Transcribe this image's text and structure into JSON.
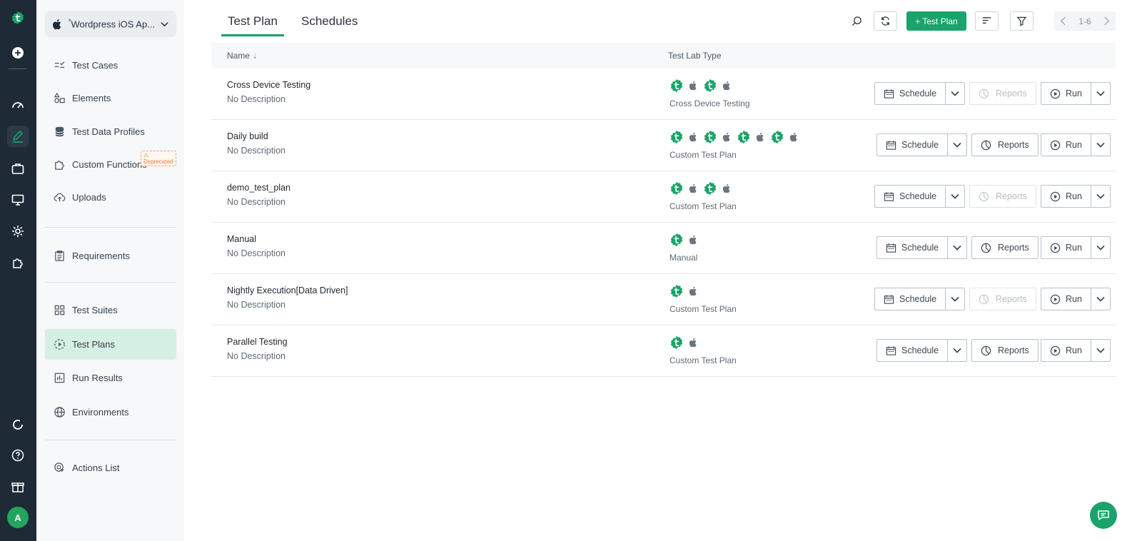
{
  "rail": {
    "avatar_letter": "A"
  },
  "sidebar": {
    "project": {
      "modified_mark": "*",
      "name": "Wordpress iOS Ap..."
    },
    "items": [
      {
        "label": "Test Cases"
      },
      {
        "label": "Elements"
      },
      {
        "label": "Test Data Profiles"
      },
      {
        "label": "Custom Functions",
        "badge": "Deprecated"
      },
      {
        "label": "Uploads"
      },
      {
        "label": "Requirements"
      },
      {
        "label": "Test Suites"
      },
      {
        "label": "Test Plans"
      },
      {
        "label": "Run Results"
      },
      {
        "label": "Environments"
      },
      {
        "label": "Actions List"
      }
    ]
  },
  "header": {
    "tabs": [
      {
        "label": "Test Plan"
      },
      {
        "label": "Schedules"
      }
    ],
    "new_button": "+ Test Plan",
    "pagination": "1-6"
  },
  "table": {
    "columns": {
      "name": "Name",
      "lab_type": "Test Lab Type"
    },
    "rows": [
      {
        "title": "Cross Device Testing",
        "desc": "No Description",
        "lab_type": "Cross Device Testing",
        "icons": 2,
        "reports_enabled": false
      },
      {
        "title": "Daily build",
        "desc": "No Description",
        "lab_type": "Custom Test Plan",
        "icons": 4,
        "reports_enabled": true
      },
      {
        "title": "demo_test_plan",
        "desc": "No Description",
        "lab_type": "Custom Test Plan",
        "icons": 2,
        "reports_enabled": false
      },
      {
        "title": "Manual",
        "desc": "No Description",
        "lab_type": "Manual",
        "icons": 1,
        "reports_enabled": true
      },
      {
        "title": "Nightly Execution[Data Driven]",
        "desc": "No Description",
        "lab_type": "Custom Test Plan",
        "icons": 1,
        "reports_enabled": false
      },
      {
        "title": "Parallel Testing",
        "desc": "No Description",
        "lab_type": "Custom Test Plan",
        "icons": 1,
        "reports_enabled": true
      }
    ],
    "schedule_label": "Schedule",
    "reports_label": "Reports",
    "run_label": "Run"
  },
  "colors": {
    "accent": "#1aa36a",
    "rail_bg": "#1e2a36"
  }
}
